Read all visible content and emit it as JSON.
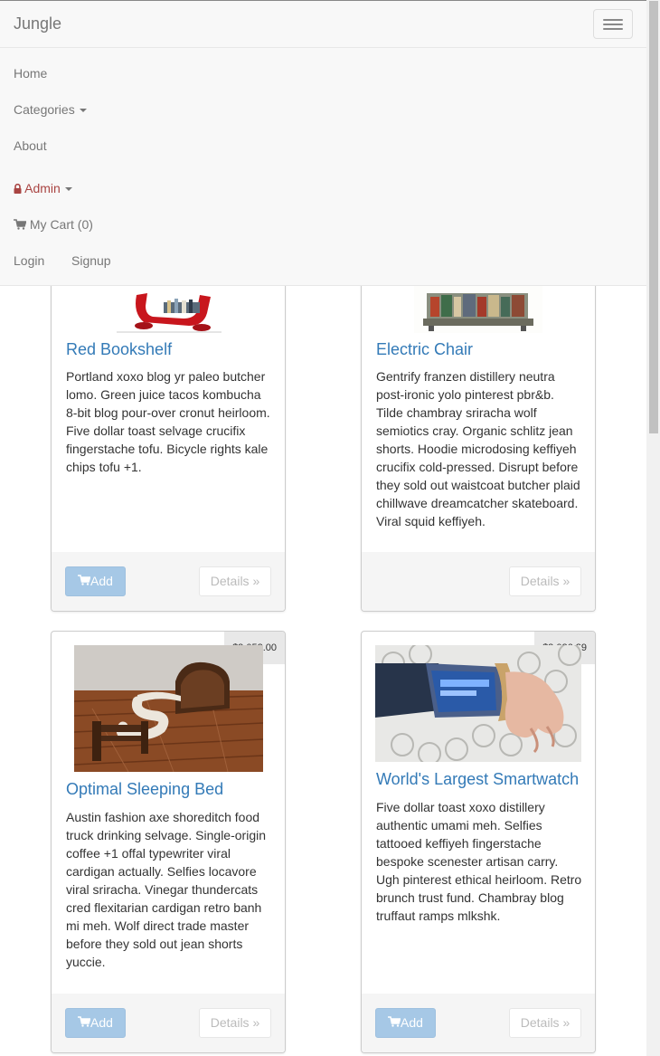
{
  "navbar": {
    "brand": "Jungle",
    "items": [
      {
        "label": "Home"
      },
      {
        "label": "Categories"
      },
      {
        "label": "About"
      },
      {
        "label": "Admin"
      },
      {
        "label": "My Cart (0)"
      },
      {
        "label": "Login"
      },
      {
        "label": "Signup"
      }
    ]
  },
  "products": [
    {
      "name": "Red Bookshelf",
      "description": "Portland xoxo blog yr paleo butcher lomo. Green juice tacos kombucha 8-bit blog pour-over cronut heirloom. Five dollar toast selvage crucifix fingerstache tofu. Bicycle rights kale chips tofu +1.",
      "add_label": "Add",
      "details_label": "Details »"
    },
    {
      "name": "Electric Chair",
      "description": "Gentrify franzen distillery neutra post-ironic yolo pinterest pbr&b. Tilde chambray sriracha wolf semiotics cray. Organic schlitz jean shorts. Hoodie microdosing keffiyeh crucifix cold-pressed. Disrupt before they sold out waistcoat butcher plaid chillwave dreamcatcher skateboard. Viral squid keffiyeh.",
      "details_label": "Details »"
    },
    {
      "name": "Optimal Sleeping Bed",
      "price": "$3,052.00",
      "description": "Austin fashion axe shoreditch food truck drinking selvage. Single-origin coffee +1 offal typewriter viral cardigan actually. Selfies locavore viral sriracha. Vinegar thundercats cred flexitarian cardigan retro banh mi meh. Wolf direct trade master before they sold out jean shorts yuccie.",
      "add_label": "Add",
      "details_label": "Details »"
    },
    {
      "name": "World's Largest Smartwatch",
      "price": "$2,026.29",
      "description": "Five dollar toast xoxo distillery authentic umami meh. Selfies tattooed keffiyeh fingerstache bespoke scenester artisan carry. Ugh pinterest ethical heirloom. Retro brunch trust fund. Chambray blog truffaut ramps mlkshk.",
      "add_label": "Add",
      "details_label": "Details »"
    }
  ],
  "colors": {
    "link": "#337ab7",
    "admin": "#a94442",
    "add_button": "#a6c8e6",
    "navbar_bg": "#f8f8f8"
  }
}
